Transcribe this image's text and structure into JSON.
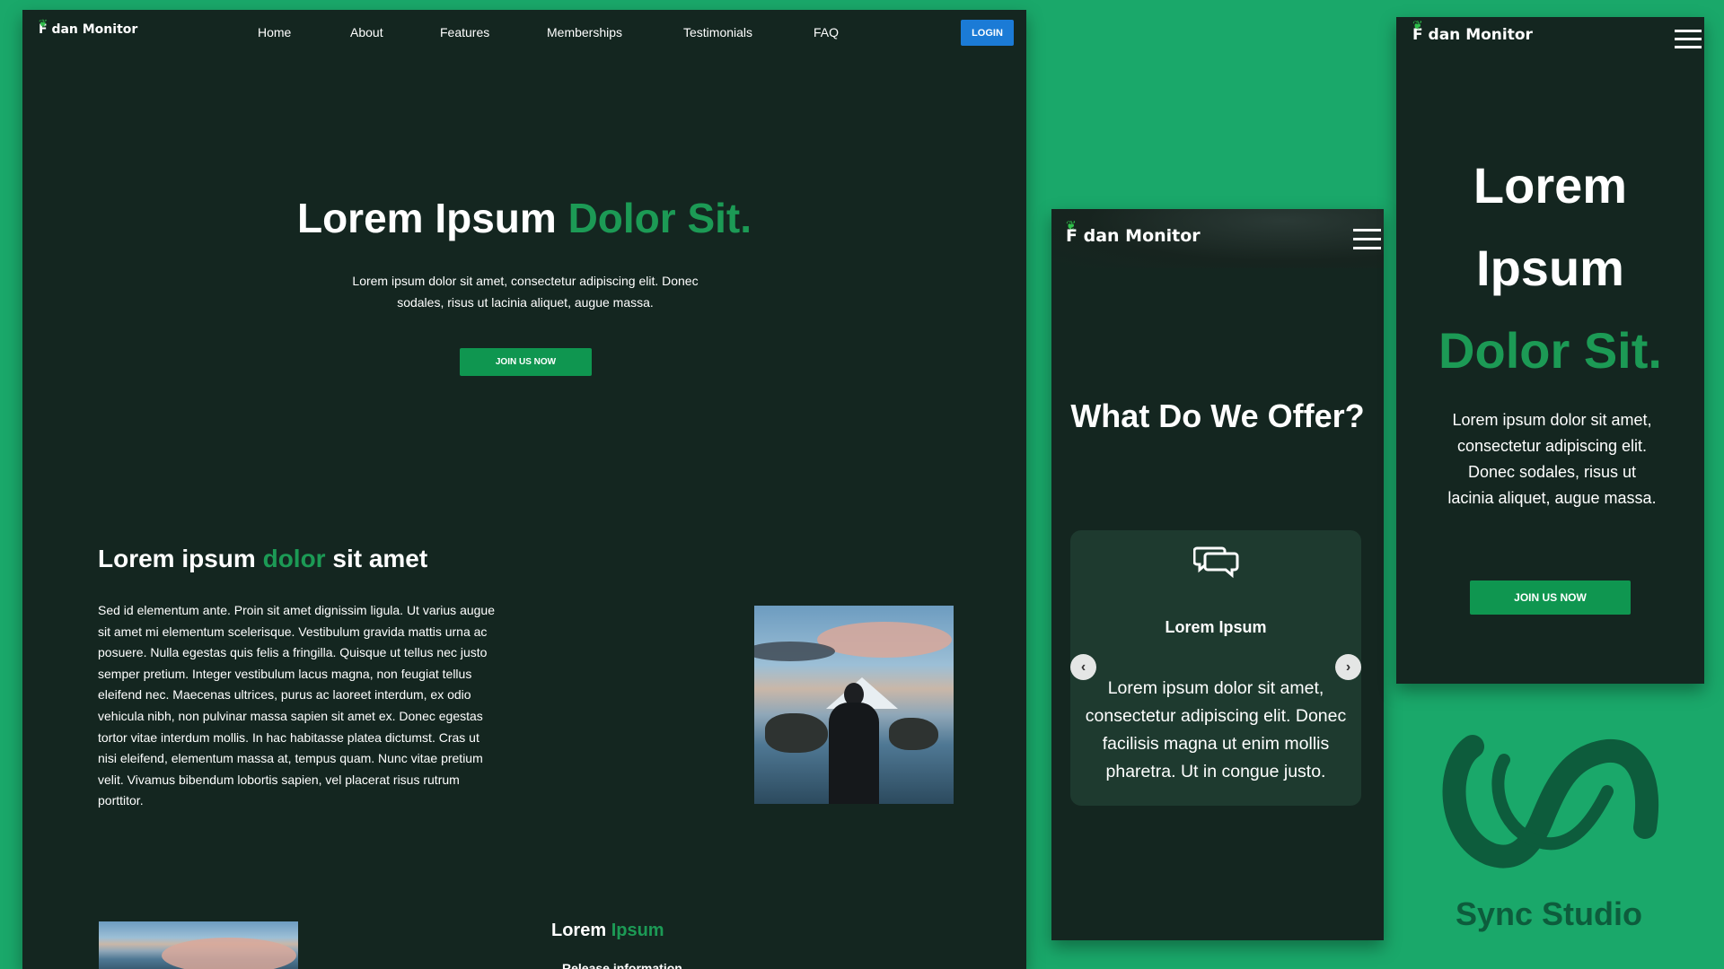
{
  "desktop": {
    "logo": "F dan Monitor",
    "nav": [
      "Home",
      "About",
      "Features",
      "Memberships",
      "Testimonials",
      "FAQ"
    ],
    "login": "LOGIN",
    "hero": {
      "title_white": "Lorem Ipsum ",
      "title_green": "Dolor Sit.",
      "text": "Lorem ipsum dolor sit amet, consectetur adipiscing elit. Donec sodales, risus ut lacinia aliquet, augue massa.",
      "button": "JOIN US NOW"
    },
    "section": {
      "title_a": "Lorem ipsum ",
      "title_green": "dolor",
      "title_b": " sit amet",
      "text": "Sed id elementum ante. Proin sit amet dignissim ligula. Ut varius augue sit amet mi elementum scelerisque. Vestibulum gravida mattis urna ac posuere. Nulla egestas quis felis a fringilla. Quisque ut tellus nec justo semper pretium. Integer vestibulum lacus magna, non feugiat tellus eleifend nec. Maecenas ultrices, purus ac laoreet interdum, ex odio vehicula nibh, non pulvinar massa sapien sit amet ex. Donec egestas tortor vitae interdum mollis. In hac habitasse platea dictumst. Cras ut nisi eleifend, elementum massa at, tempus quam. Nunc vitae pretium velit. Vivamus bibendum lobortis sapien, vel placerat risus rutrum porttitor."
    },
    "lower": {
      "title_white": "Lorem ",
      "title_green": "Ipsum",
      "subtitle": "Release information"
    }
  },
  "tablet": {
    "logo": "F dan Monitor",
    "title": "What Do We Offer?",
    "card_title": "Lorem Ipsum",
    "card_text": "Lorem ipsum dolor sit amet, consectetur adipiscing elit. Donec facilisis magna ut enim mollis pharetra. Ut in congue justo.",
    "arrow_left": "‹",
    "arrow_right": "›"
  },
  "phone": {
    "logo": "F dan Monitor",
    "title_line1": "Lorem",
    "title_line2": "Ipsum",
    "title_line3": "Dolor Sit.",
    "text": "Lorem ipsum dolor sit amet, consectetur adipiscing elit. Donec sodales, risus ut lacinia aliquet, augue massa.",
    "button": "JOIN US NOW"
  },
  "brand": {
    "name": "Sync Studio"
  },
  "icons": {
    "leaf": "leaf-icon",
    "menu": "hamburger-menu-icon",
    "chat": "chat-bubbles-icon",
    "logo": "sync-studio-logo"
  },
  "colors": {
    "background": "#1aa86a",
    "panel": "#142620",
    "accent_green": "#1c9a55",
    "button_green": "#0f9650",
    "login_blue": "#1b7bd6",
    "card": "#1e3a2f",
    "brand": "#0d5c3c"
  }
}
